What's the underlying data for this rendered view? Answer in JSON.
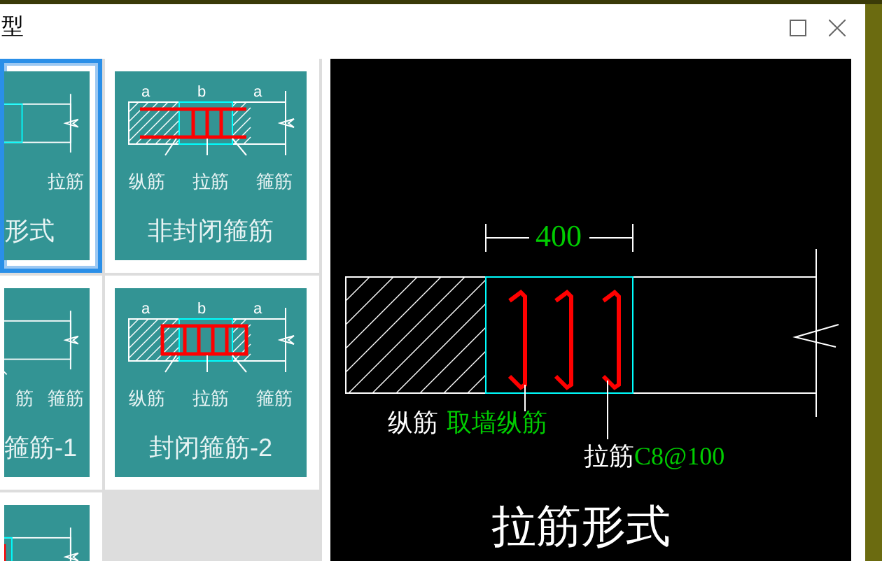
{
  "window": {
    "title": "型"
  },
  "tiles": [
    {
      "kind": "tie",
      "selected": true,
      "labels": [
        "拉筋"
      ],
      "title": "形式"
    },
    {
      "kind": "open",
      "selected": false,
      "dims": [
        "a",
        "b",
        "a"
      ],
      "labels": [
        "纵筋",
        "拉筋",
        "箍筋"
      ],
      "title": "非封闭箍筋"
    },
    {
      "kind": "closed1",
      "selected": false,
      "labels": [
        "筋",
        "箍筋"
      ],
      "title": "箍筋-1"
    },
    {
      "kind": "closed2",
      "selected": false,
      "dims": [
        "a",
        "b",
        "a"
      ],
      "labels": [
        "纵筋",
        "拉筋",
        "箍筋"
      ],
      "title": "封闭箍筋-2"
    },
    {
      "kind": "partial",
      "selected": false
    }
  ],
  "preview": {
    "dimension": "400",
    "rebar_label": "纵筋",
    "rebar_value": "取墙纵筋",
    "tie_label": "拉筋",
    "tie_value": "C8@100",
    "title": "拉筋形式"
  }
}
